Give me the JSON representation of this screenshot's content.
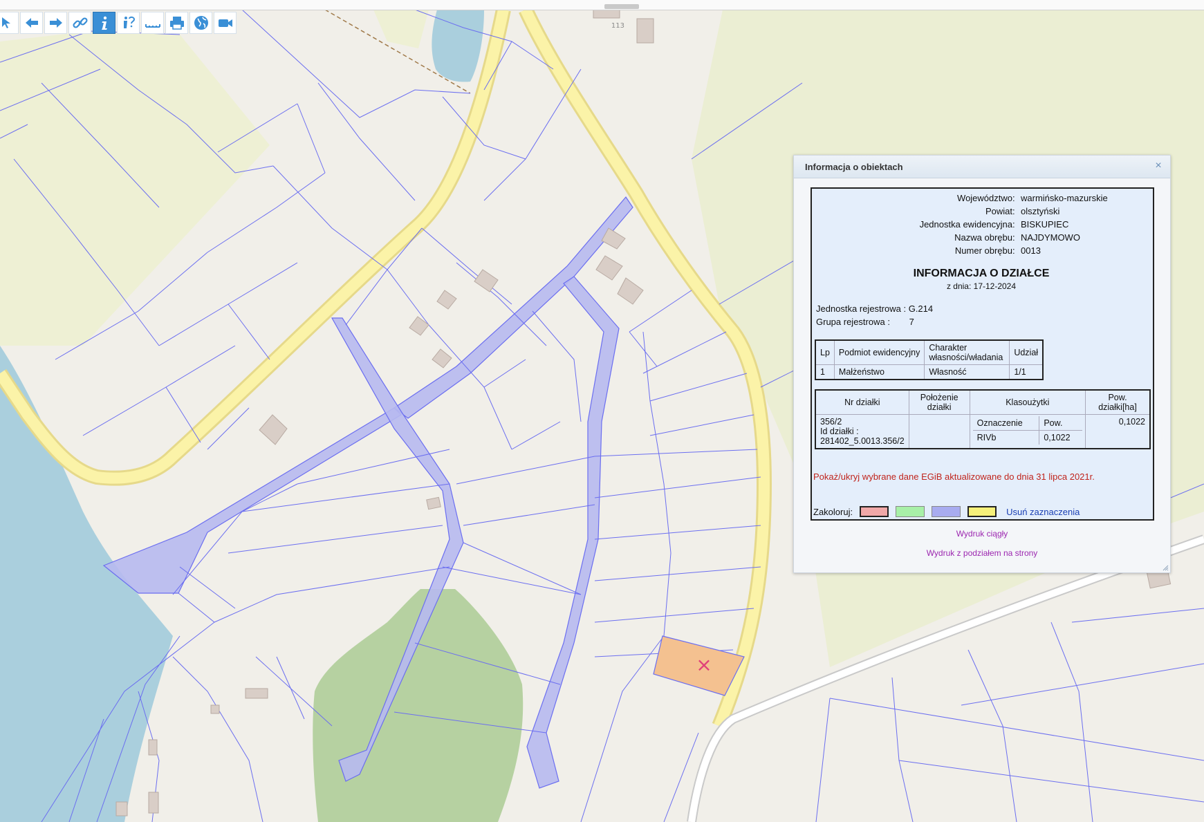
{
  "toolbar": {
    "buttons": [
      {
        "name": "measure-tool",
        "icon": "pointer-icon"
      },
      {
        "name": "back",
        "icon": "arrow-left-icon"
      },
      {
        "name": "forward",
        "icon": "arrow-right-icon"
      },
      {
        "name": "link",
        "icon": "link-icon"
      },
      {
        "name": "info",
        "icon": "info-icon",
        "active": true
      },
      {
        "name": "info-query",
        "icon": "info-question-icon"
      },
      {
        "name": "measure-distance",
        "icon": "ruler-icon"
      },
      {
        "name": "print",
        "icon": "printer-icon"
      },
      {
        "name": "globe",
        "icon": "globe-icon"
      },
      {
        "name": "video",
        "icon": "camera-icon"
      }
    ],
    "accent": "#3a8fd6"
  },
  "map": {
    "building_label": "113",
    "selected_marker": "×",
    "colors": {
      "background": "#f1efe9",
      "water": "#aacfdd",
      "meadow": "#eef0d4",
      "forest": "#b6d1a1",
      "road_fill": "#fbf3a8",
      "road_edge": "#e9dd8c",
      "parcel_line": "#6b6ef0",
      "highlight": "#b7b9f0",
      "selected": "#f4c190"
    }
  },
  "panel": {
    "title": "Informacja o obiektach",
    "close_label": "×",
    "location": [
      {
        "key": "Województwo",
        "value": "warmińsko-mazurskie"
      },
      {
        "key": "Powiat",
        "value": "olsztyński"
      },
      {
        "key": "Jednostka ewidencyjna",
        "value": "BISKUPIEC"
      },
      {
        "key": "Nazwa obrębu",
        "value": "NAJDYMOWO"
      },
      {
        "key": "Numer obrębu",
        "value": "0013"
      }
    ],
    "heading": "INFORMACJA O DZIAŁCE",
    "date_line": "z dnia: 17-12-2024",
    "registry_unit_label": "Jednostka rejestrowa :",
    "registry_unit_value": "G.214",
    "registry_group_label": "Grupa rejestrowa :",
    "registry_group_value": "7",
    "owners_table": {
      "headers": [
        "Lp",
        "Podmiot ewidencyjny",
        "Charakter własności/władania",
        "Udział"
      ],
      "rows": [
        [
          "1",
          "Małżeństwo",
          "Własność",
          "1/1"
        ]
      ]
    },
    "parcel_table": {
      "headers": [
        "Nr działki",
        "Położenie działki",
        "Klasoużytki",
        "Pow. działki[ha]"
      ],
      "parcel_number": "356/2",
      "parcel_id_label": "Id działki :",
      "parcel_id": "281402_5.0013.356/2",
      "location": "",
      "class_headers": [
        "Oznaczenie",
        "Pow."
      ],
      "class_rows": [
        [
          "RIVb",
          "0,1022"
        ]
      ],
      "area": "0,1022"
    },
    "toggle_link": "Pokaż/ukryj wybrane dane EGiB aktualizowane do dnia 31 lipca 2021r.",
    "colorize_label": "Zakoloruj:",
    "swatches": [
      {
        "name": "red",
        "color": "#f0a8a8",
        "border": "#222"
      },
      {
        "name": "green",
        "color": "#a8f0a8",
        "border": "#888"
      },
      {
        "name": "blue",
        "color": "#a8acf0",
        "border": "#888"
      },
      {
        "name": "yellow",
        "color": "#f5f07a",
        "border": "#222"
      }
    ],
    "clear_link": "Usuń zaznaczenia",
    "print_continuous": "Wydruk ciągły",
    "print_paged": "Wydruk z podziałem na strony"
  }
}
